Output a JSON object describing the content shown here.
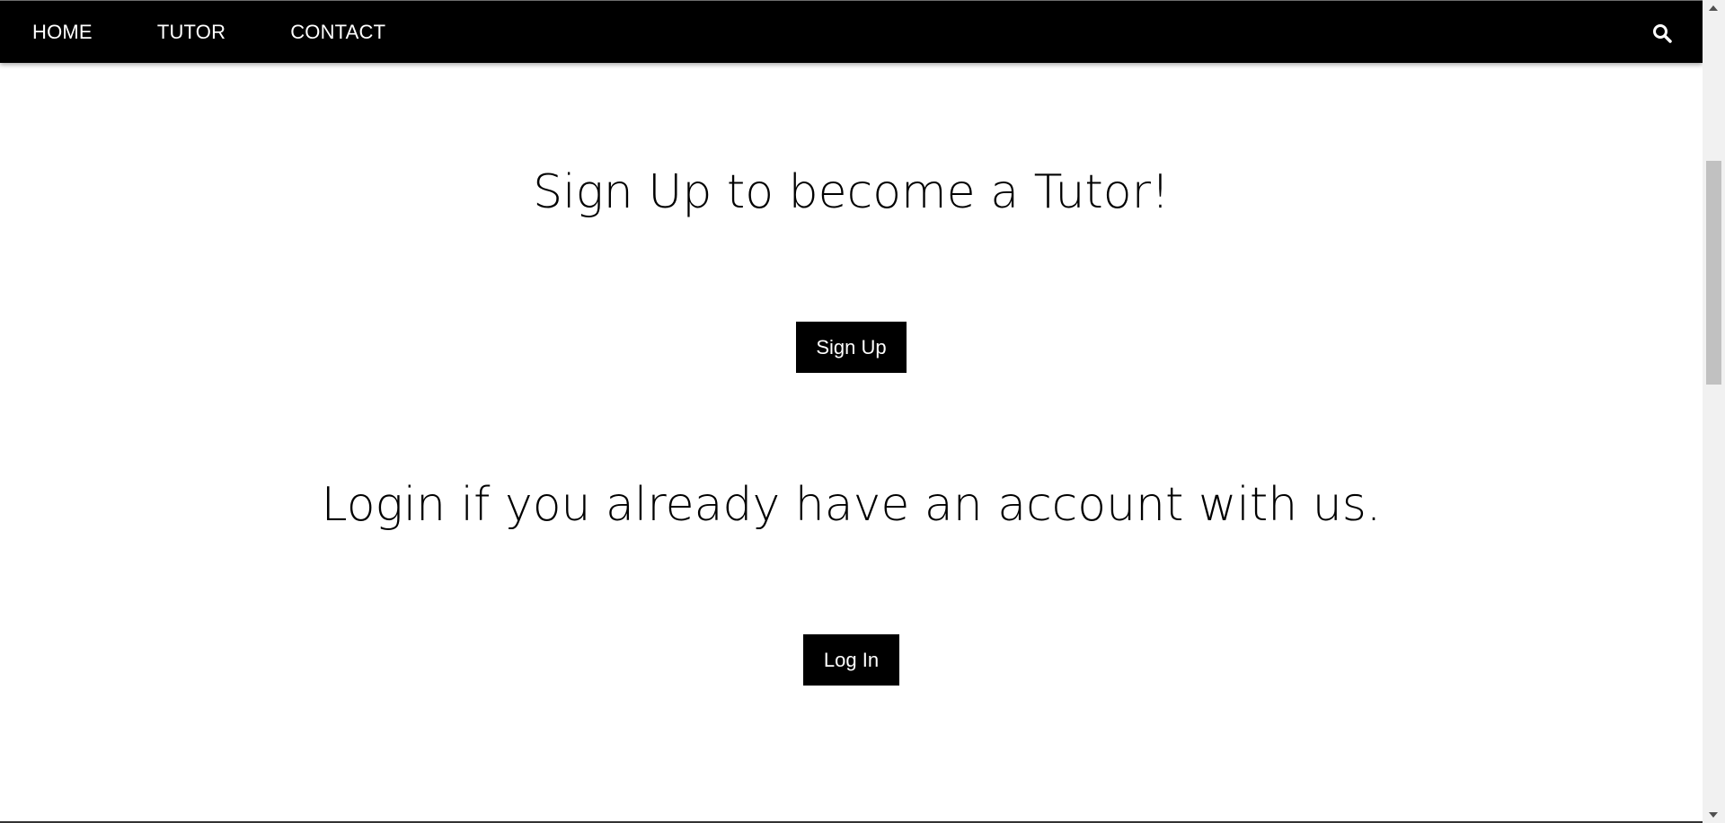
{
  "nav": {
    "items": [
      {
        "label": "HOME"
      },
      {
        "label": "TUTOR"
      },
      {
        "label": "CONTACT"
      }
    ],
    "search_icon": "search-icon"
  },
  "main": {
    "signup_heading": "Sign Up to become a Tutor!",
    "signup_button": "Sign Up",
    "login_heading": "Login if you already have an account with us.",
    "login_button": "Log In"
  },
  "colors": {
    "navbar_bg": "#000000",
    "button_bg": "#000000",
    "text": "#000000",
    "button_text": "#ffffff"
  }
}
